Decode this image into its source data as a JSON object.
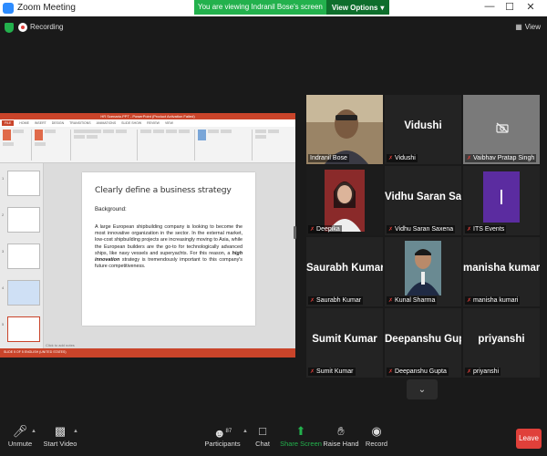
{
  "window": {
    "title": "Zoom Meeting",
    "banner_text": "You are viewing Indranil Bose's screen",
    "view_options_label": "View Options"
  },
  "status": {
    "recording_label": "Recording",
    "view_label": "View"
  },
  "presentation": {
    "window_title": "HR Scenario.PPT - PowerPoint (Product Activation Failed)",
    "ribbon_tabs": [
      "FILE",
      "HOME",
      "INSERT",
      "DESIGN",
      "TRANSITIONS",
      "ANIMATIONS",
      "SLIDE SHOW",
      "REVIEW",
      "VIEW"
    ],
    "slide_title": "Clearly define a business strategy",
    "background_label": "Background:",
    "paragraph_pre": "A large European shipbuilding company is looking to become the most innovative organization in the sector. In the external market, low-cost shipbuilding projects are increasingly moving to Asia, while the European builders are the go-to for technologically advanced ships, like navy vessels and superyachts. For this reason, a ",
    "paragraph_emph": "high innovation",
    "paragraph_post": " strategy is tremendously important to this company's future competitiveness.",
    "notes_label": "Click to add notes",
    "status_text": "SLIDE 5 OF 5     ENGLISH (UNITED STATES)",
    "thumb_numbers": [
      "1",
      "2",
      "3",
      "4",
      "5"
    ]
  },
  "participants": [
    {
      "name": "Indranil Bose",
      "has_video": true,
      "speaking": true,
      "muted": false
    },
    {
      "name": "Vidushi",
      "display": "Vidushi",
      "muted": true
    },
    {
      "name": "Vaibhav Pratap Singh",
      "muted": true,
      "icon": "camera-off-icon"
    },
    {
      "name": "Deepika",
      "has_video": true,
      "muted": true
    },
    {
      "name": "Vidhu Saran Saxena",
      "display": "Vidhu Saran Sa...",
      "muted": true
    },
    {
      "name": "ITS Events",
      "muted": true,
      "avatar_color": "#5b2ca0"
    },
    {
      "name": "Saurabh Kumar",
      "display": "Saurabh Kumar",
      "muted": true
    },
    {
      "name": "Kunal Sharma",
      "has_video": true,
      "muted": true
    },
    {
      "name": "manisha kumari",
      "display": "manisha kumari",
      "muted": true
    },
    {
      "name": "Sumit Kumar",
      "display": "Sumit Kumar",
      "muted": true
    },
    {
      "name": "Deepanshu Gupta",
      "display": "Deepanshu Gupta",
      "muted": true
    },
    {
      "name": "priyanshi",
      "display": "priyanshi",
      "muted": true
    }
  ],
  "toolbar": {
    "unmute": "Unmute",
    "start_video": "Start Video",
    "participants": "Participants",
    "participants_count": "87",
    "chat": "Chat",
    "share_screen": "Share Screen",
    "raise_hand": "Raise Hand",
    "record": "Record",
    "leave": "Leave"
  },
  "colors": {
    "accent_green": "#23b14d",
    "leave_red": "#e0403a",
    "speaking_outline": "#b6e24a",
    "ppt_brand": "#c9442a"
  }
}
